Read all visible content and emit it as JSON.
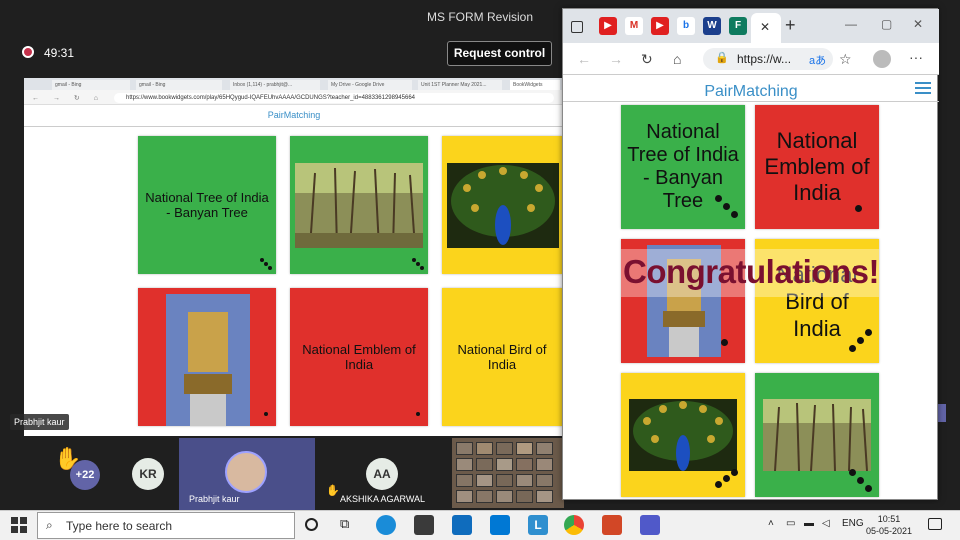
{
  "window": {
    "title": "MS FORM Revision"
  },
  "meeting": {
    "timer": "49:31",
    "request_control": "Request control",
    "shared_presenter": "Prabhjit kaur",
    "raise_count": "+22",
    "participants": [
      {
        "initials": "KR"
      },
      {
        "name": "Prabhjit kaur"
      },
      {
        "initials": "AA",
        "name": "AKSHIKA AGARWAL"
      }
    ]
  },
  "shared": {
    "tabs": [
      "gmail - Bing",
      "gmail - Bing",
      "Inbox (1,114) - prabhjit@...",
      "My Drive - Google Drive",
      "Unit 1ST Planner May 2021...",
      "BookWidgets"
    ],
    "url": "https://www.bookwidgets.com/play/65HQygud-IQAFEUhvAAAA/GCDUNGS?teacher_id=4883361298945664",
    "brand": "PairMatching",
    "cards": [
      {
        "text": "National Tree of India - Banyan Tree"
      },
      {
        "text": "National Emblem of India"
      },
      {
        "text": "National Bird of India"
      }
    ]
  },
  "browser": {
    "url": "https://w...",
    "brand": "PairMatching",
    "congrats": "Congratulations!",
    "cards": [
      {
        "text": "National Tree of India - Banyan Tree"
      },
      {
        "text": "National Emblem of India"
      },
      {
        "text": "National Bird of India"
      }
    ]
  },
  "taskbar": {
    "search_placeholder": "Type here to search",
    "lang": "ENG",
    "time": "10:51",
    "date": "05-05-2021"
  }
}
